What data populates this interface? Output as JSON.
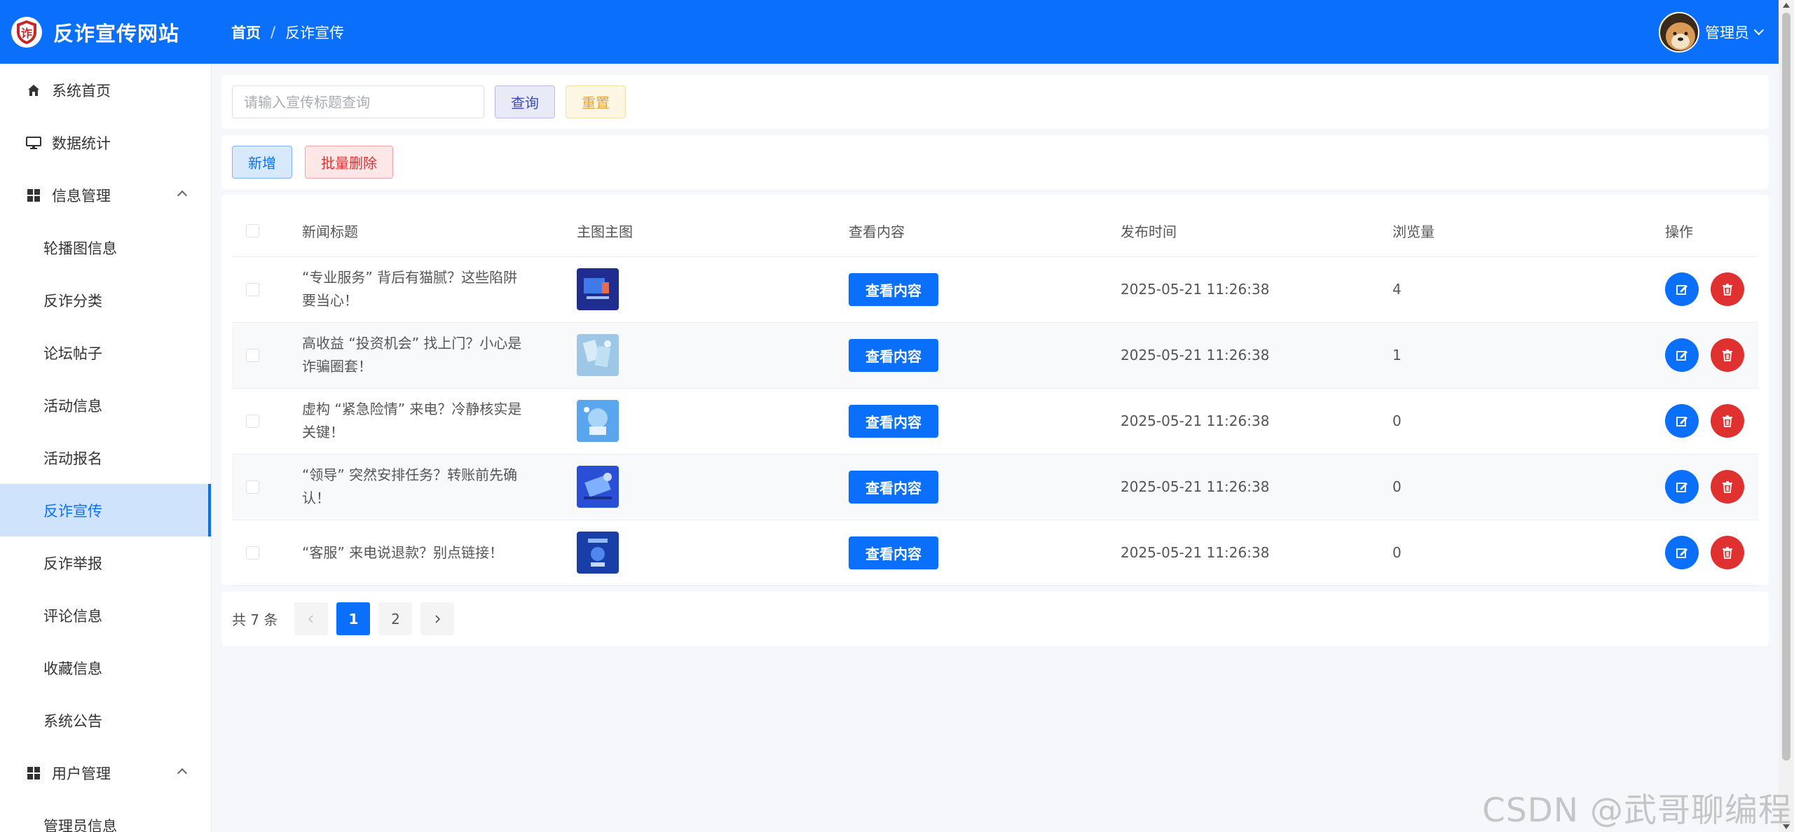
{
  "header": {
    "site_title": "反诈宣传网站",
    "logo_char": "诈",
    "breadcrumb": [
      "首页",
      "反诈宣传"
    ],
    "user_name": "管理员",
    "bg_color": "#0a6ffa"
  },
  "sidebar": {
    "items": [
      {
        "label": "系统首页",
        "icon": "home-icon",
        "type": "top"
      },
      {
        "label": "数据统计",
        "icon": "monitor-icon",
        "type": "top"
      },
      {
        "label": "信息管理",
        "icon": "grid-icon",
        "type": "group",
        "expanded": true
      },
      {
        "label": "轮播图信息",
        "type": "sub"
      },
      {
        "label": "反诈分类",
        "type": "sub"
      },
      {
        "label": "论坛帖子",
        "type": "sub"
      },
      {
        "label": "活动信息",
        "type": "sub"
      },
      {
        "label": "活动报名",
        "type": "sub"
      },
      {
        "label": "反诈宣传",
        "type": "sub",
        "active": true
      },
      {
        "label": "反诈举报",
        "type": "sub"
      },
      {
        "label": "评论信息",
        "type": "sub"
      },
      {
        "label": "收藏信息",
        "type": "sub"
      },
      {
        "label": "系统公告",
        "type": "sub"
      },
      {
        "label": "用户管理",
        "icon": "grid-icon",
        "type": "group",
        "expanded": true
      },
      {
        "label": "管理员信息",
        "type": "sub"
      }
    ]
  },
  "search": {
    "placeholder": "请输入宣传标题查询",
    "value": "",
    "query_label": "查询",
    "reset_label": "重置"
  },
  "actions": {
    "add_label": "新增",
    "batch_delete_label": "批量删除"
  },
  "table": {
    "columns": [
      "新闻标题",
      "主图主图",
      "查看内容",
      "发布时间",
      "浏览量",
      "操作"
    ],
    "view_label": "查看内容",
    "rows": [
      {
        "title": "“专业服务” 背后有猫腻？这些陷阱要当心！",
        "time": "2025-05-21 11:26:38",
        "views": "4"
      },
      {
        "title": "高收益 “投资机会” 找上门？小心是诈骗圈套！",
        "time": "2025-05-21 11:26:38",
        "views": "1"
      },
      {
        "title": "虚构 “紧急险情” 来电？冷静核实是关键！",
        "time": "2025-05-21 11:26:38",
        "views": "0"
      },
      {
        "title": "“领导” 突然安排任务？转账前先确认！",
        "time": "2025-05-21 11:26:38",
        "views": "0"
      },
      {
        "title": "“客服” 来电说退款？别点链接！",
        "time": "2025-05-21 11:26:38",
        "views": "0"
      }
    ]
  },
  "pager": {
    "total": "共 7 条",
    "pages": [
      "1",
      "2"
    ],
    "current": "1"
  },
  "watermark": "CSDN @武哥聊编程"
}
